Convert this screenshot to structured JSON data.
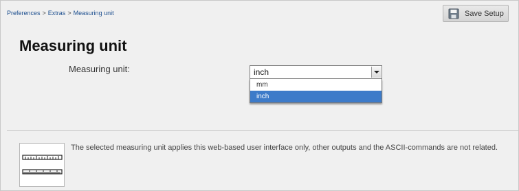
{
  "breadcrumb": {
    "items": [
      "Preferences",
      "Extras",
      "Measuring unit"
    ],
    "separator": ">"
  },
  "toolbar": {
    "save_label": "Save Setup",
    "save_icon": "floppy-disk-icon"
  },
  "page": {
    "title": "Measuring unit"
  },
  "measuring_unit": {
    "label": "Measuring unit:",
    "selected": "inch",
    "options": [
      "mm",
      "inch"
    ]
  },
  "info": {
    "icon": "ruler-icon",
    "text": "The selected measuring unit applies this web-based user interface only, other outputs and the ASCII-commands are not related."
  },
  "colors": {
    "accent": "#3d7bc9",
    "breadcrumb_link": "#1d4f8f"
  }
}
